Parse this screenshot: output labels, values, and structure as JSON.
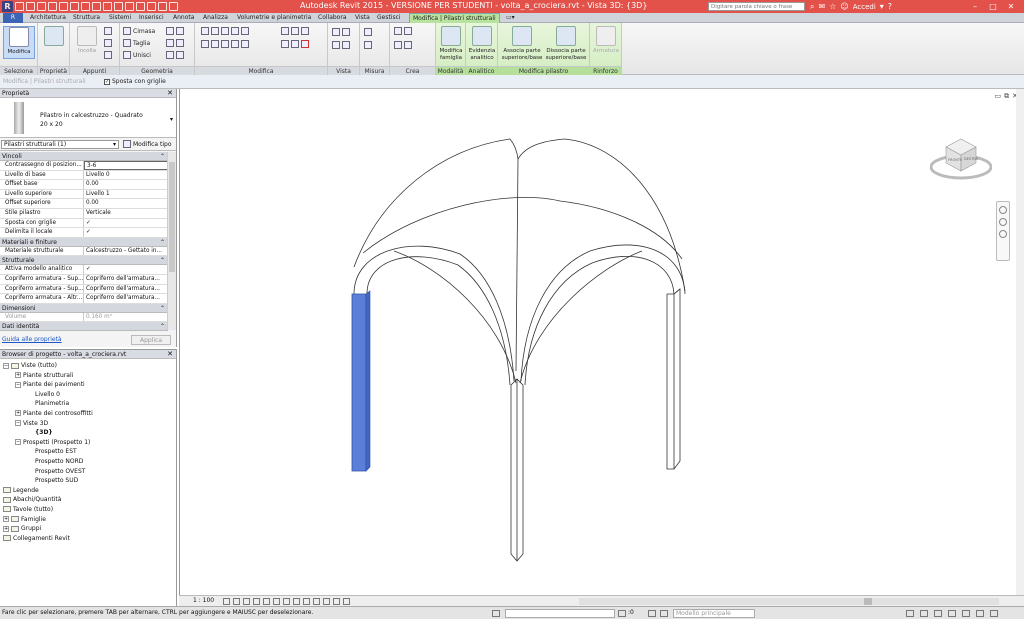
{
  "titlebar": {
    "title": "Autodesk Revit 2015 - VERSIONE PER STUDENTI -    volta_a_crociera.rvt - Vista 3D: {3D}",
    "search_placeholder": "Digitare parola chiave o frase",
    "signin": "Accedi"
  },
  "menu": {
    "tabs": [
      "Architettura",
      "Struttura",
      "Sistemi",
      "Inserisci",
      "Annota",
      "Analizza",
      "Volumetrie e planimetria",
      "Collabora",
      "Vista",
      "Gestisci",
      "Modifica | Pilastri strutturali"
    ]
  },
  "ribbon": {
    "modify_label": "Modifica",
    "groups": {
      "seleziona": "Seleziona",
      "proprieta": "Proprietà",
      "appunti": "Appunti",
      "geometria": "Geometria",
      "modifica": "Modifica",
      "vista": "Vista",
      "misura": "Misura",
      "crea": "Crea",
      "modalita": "Modalità",
      "analitico": "Analitico",
      "modifica_pilastro": "Modifica pilastro",
      "rinforzo": "Rinforzo"
    },
    "clipboard": {
      "incolla": "Incolla"
    },
    "geometry": {
      "cimasa": "Cimasa",
      "taglia": "Taglia",
      "unisci": "Unisci"
    },
    "buttons": {
      "modifica_famiglia": "Modifica famiglia",
      "evidenzia_analitico": "Evidenzia analitico",
      "associa": "Associa parte superiore/base",
      "dissocia": "Dissocia parte superiore/base",
      "armatura": "Armatura"
    }
  },
  "optionsbar": {
    "context": "Modifica | Pilastri strutturali",
    "sposta_con_griglie": "Sposta con griglie"
  },
  "properties": {
    "title": "Proprietà",
    "type_name": "Pilastro in calcestruzzo - Quadrato",
    "type_size": "20 x 20",
    "instance_selector": "Pilastri strutturali (1)",
    "edit_type": "Modifica tipo",
    "sections": [
      {
        "name": "Vincoli",
        "rows": [
          {
            "k": "Contrassegno di posizion...",
            "v": "3-6"
          },
          {
            "k": "Livello di base",
            "v": "Livello 0"
          },
          {
            "k": "Offset base",
            "v": "0.00"
          },
          {
            "k": "Livello superiore",
            "v": "Livello 1"
          },
          {
            "k": "Offset superiore",
            "v": "0.00"
          },
          {
            "k": "Stile pilastro",
            "v": "Verticale"
          },
          {
            "k": "Sposta con griglie",
            "v": "✓"
          },
          {
            "k": "Delimita il locale",
            "v": "✓"
          }
        ]
      },
      {
        "name": "Materiali e finiture",
        "rows": [
          {
            "k": "Materiale strutturale",
            "v": "Calcestruzzo - Gettato in..."
          }
        ]
      },
      {
        "name": "Strutturale",
        "rows": [
          {
            "k": "Attiva modello analitico",
            "v": "✓"
          },
          {
            "k": "Copriferro armatura - Sup...",
            "v": "Copriferro dell'armatura..."
          },
          {
            "k": "Copriferro armatura - Sup...",
            "v": "Copriferro dell'armatura..."
          },
          {
            "k": "Copriferro armatura - Altr...",
            "v": "Copriferro dell'armatura..."
          }
        ]
      },
      {
        "name": "Dimensioni",
        "rows": [
          {
            "k": "Volume",
            "v": "0.160 m³",
            "grey": true
          }
        ]
      },
      {
        "name": "Dati identità",
        "rows": []
      }
    ],
    "help_link": "Guida alle proprietà",
    "apply": "Applica"
  },
  "browser": {
    "title": "Browser di progetto - volta_a_crociera.rvt",
    "nodes": [
      {
        "label": "Viste (tutto)",
        "indent": 0,
        "toggle": "−",
        "icon": "views-icon"
      },
      {
        "label": "Piante strutturali",
        "indent": 1,
        "toggle": "+"
      },
      {
        "label": "Piante dei pavimenti",
        "indent": 1,
        "toggle": "−"
      },
      {
        "label": "Livello 0",
        "indent": 2
      },
      {
        "label": "Planimetria",
        "indent": 2
      },
      {
        "label": "Piante dei controsoffitti",
        "indent": 1,
        "toggle": "+"
      },
      {
        "label": "Viste 3D",
        "indent": 1,
        "toggle": "−"
      },
      {
        "label": "{3D}",
        "indent": 2,
        "bold": true
      },
      {
        "label": "Prospetti (Prospetto 1)",
        "indent": 1,
        "toggle": "−"
      },
      {
        "label": "Prospetto EST",
        "indent": 2
      },
      {
        "label": "Prospetto NORD",
        "indent": 2
      },
      {
        "label": "Prospetto OVEST",
        "indent": 2
      },
      {
        "label": "Prospetto SUD",
        "indent": 2
      },
      {
        "label": "Legende",
        "indent": 0,
        "icon": "legend-icon"
      },
      {
        "label": "Abachi/Quantità",
        "indent": 0,
        "icon": "schedule-icon"
      },
      {
        "label": "Tavole (tutto)",
        "indent": 0,
        "icon": "sheet-icon"
      },
      {
        "label": "Famiglie",
        "indent": 0,
        "toggle": "+",
        "icon": "family-icon"
      },
      {
        "label": "Gruppi",
        "indent": 0,
        "toggle": "+",
        "icon": "group-icon"
      },
      {
        "label": "Collegamenti Revit",
        "indent": 0,
        "icon": "link-icon"
      }
    ]
  },
  "viewcube": {
    "front": "FRONTE",
    "right": "DESTRA"
  },
  "viewbar": {
    "scale": "1 : 100"
  },
  "statusbar": {
    "message": "Fare clic per selezionare, premere TAB per alternare, CTRL per aggiungere e MAIUSC per deselezionare.",
    "zero": ":0",
    "model": "Modello principale"
  },
  "colors": {
    "titlebar": "#e2514a",
    "selection": "#5b7fd9",
    "ribbon_context": "#b8e39f"
  }
}
